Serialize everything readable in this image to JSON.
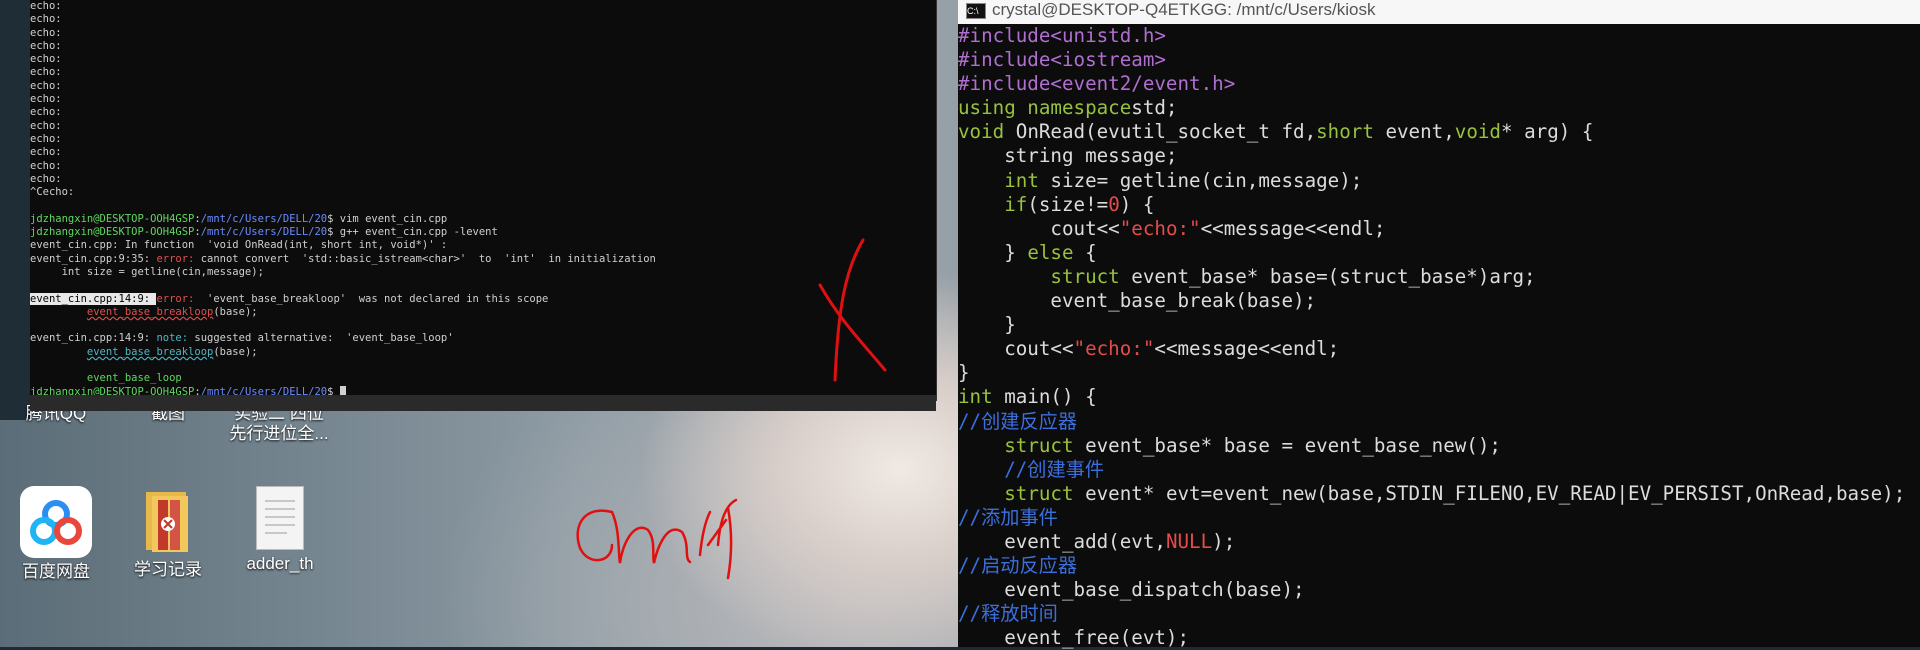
{
  "left_terminal": {
    "echo_lines": [
      "echo:",
      "echo:",
      "echo:",
      "echo:",
      "echo:",
      "echo:",
      "echo:",
      "echo:",
      "echo:",
      "echo:",
      "echo:",
      "echo:",
      "echo:",
      "echo:"
    ],
    "ctrl_c": "^Cecho:",
    "prompt_user": "jdzhangxin@DESKTOP-OOH4GSP",
    "prompt_path": "/mnt/c/Users/DELL/20",
    "cmd1": "$ vim event_cin.cpp",
    "cmd2": "$ g++ event_cin.cpp -levent",
    "out1": "event_cin.cpp: In function  'void OnRead(int, short int, void*)' :",
    "out2_a": "event_cin.cpp:9:35: ",
    "out2_err": "error:",
    "out2_b": " cannot convert  'std::basic_istream<char>'  to  'int'  in initialization",
    "out3": "     int size = getline(cin,message);",
    "out4_a": "event_cin.cpp:14:9: ",
    "out4_err": "error:",
    "out4_b": "  'event_base_breakloop'  was not declared in this scope",
    "out5_fn": "event_base_breakloop",
    "out5_rest": "(base);",
    "out6_a": "event_cin.cpp:14:9: ",
    "out6_note": "note:",
    "out6_b": " suggested alternative:  'event_base_loop'",
    "out7_fn": "event_base_breakloop",
    "out7_rest": "(base);",
    "out8": "event_base_loop",
    "cmd3": "$ "
  },
  "desktop": {
    "partial_labels": [
      "腾讯QQ",
      "截图",
      "实验二 四位",
      "先行进位全..."
    ],
    "icons": [
      {
        "label": "百度网盘",
        "icon": "baidu-netdisk-icon"
      },
      {
        "label": "学习记录",
        "icon": "archive-folder-icon"
      },
      {
        "label": "adder_th",
        "icon": "text-file-icon"
      }
    ]
  },
  "right_terminal": {
    "title": "crystal@DESKTOP-Q4ETKGG: /mnt/c/Users/kiosk",
    "code_lines": [
      {
        "t": "pp",
        "s": "#include<unistd.h>"
      },
      {
        "t": "pp",
        "s": "#include<iostream>"
      },
      {
        "t": "pp",
        "s": "#include<event2/event.h>"
      },
      {
        "t": "mix",
        "parts": [
          [
            "kw",
            "using namespace"
          ],
          [
            "",
            "std;"
          ]
        ]
      },
      {
        "t": "mix",
        "parts": [
          [
            "kw",
            "void"
          ],
          [
            "",
            " OnRead(evutil_socket_t fd,"
          ],
          [
            "kw",
            "short"
          ],
          [
            "",
            " event,"
          ],
          [
            "kw",
            "void"
          ],
          [
            "",
            "* arg) {"
          ]
        ]
      },
      {
        "t": "",
        "s": "    string message;"
      },
      {
        "t": "mix",
        "parts": [
          [
            "",
            "    "
          ],
          [
            "kw",
            "int"
          ],
          [
            "",
            " size= getline(cin,message);"
          ]
        ]
      },
      {
        "t": "mix",
        "parts": [
          [
            "",
            "    "
          ],
          [
            "kw",
            "if"
          ],
          [
            "",
            "(size!="
          ],
          [
            "num",
            "0"
          ],
          [
            "",
            ") {"
          ]
        ]
      },
      {
        "t": "mix",
        "parts": [
          [
            "",
            "        cout<<"
          ],
          [
            "str",
            "\"echo:\""
          ],
          [
            "",
            "<<message<<endl;"
          ]
        ]
      },
      {
        "t": "mix",
        "parts": [
          [
            "",
            "    } "
          ],
          [
            "kw",
            "else"
          ],
          [
            "",
            " {"
          ]
        ]
      },
      {
        "t": "mix",
        "parts": [
          [
            "",
            "        "
          ],
          [
            "kw",
            "struct"
          ],
          [
            "",
            " event_base* base=(struct_base*)arg;"
          ]
        ]
      },
      {
        "t": "",
        "s": "        event_base_break(base);"
      },
      {
        "t": "",
        "s": "    }"
      },
      {
        "t": "mix",
        "parts": [
          [
            "",
            "    cout<<"
          ],
          [
            "str",
            "\"echo:\""
          ],
          [
            "",
            "<<message<<endl;"
          ]
        ]
      },
      {
        "t": "",
        "s": "}"
      },
      {
        "t": "mix",
        "parts": [
          [
            "kw",
            "int"
          ],
          [
            "",
            " main() {"
          ]
        ]
      },
      {
        "t": "cm",
        "s": "//创建反应器"
      },
      {
        "t": "mix",
        "parts": [
          [
            "",
            "    "
          ],
          [
            "kw",
            "struct"
          ],
          [
            "",
            " event_base* base = event_base_new();"
          ]
        ]
      },
      {
        "t": "cm",
        "s": "    //创建事件"
      },
      {
        "t": "mix",
        "parts": [
          [
            "",
            "    "
          ],
          [
            "kw",
            "struct"
          ],
          [
            "",
            " event* evt=event_new(base,STDIN_FILENO,EV_READ|EV_PERSIST,OnRead,base);"
          ]
        ]
      },
      {
        "t": "cm",
        "s": "//添加事件"
      },
      {
        "t": "mix",
        "parts": [
          [
            "",
            "    event_add(evt,"
          ],
          [
            "num",
            "NULL"
          ],
          [
            "",
            ");"
          ]
        ]
      },
      {
        "t": "cm",
        "s": "//启动反应器"
      },
      {
        "t": "",
        "s": "    event_base_dispatch(base);"
      },
      {
        "t": "cm",
        "s": "//释放时间"
      },
      {
        "t": "",
        "s": "    event_free(evt);"
      }
    ]
  },
  "annotation_color": "#e01010"
}
